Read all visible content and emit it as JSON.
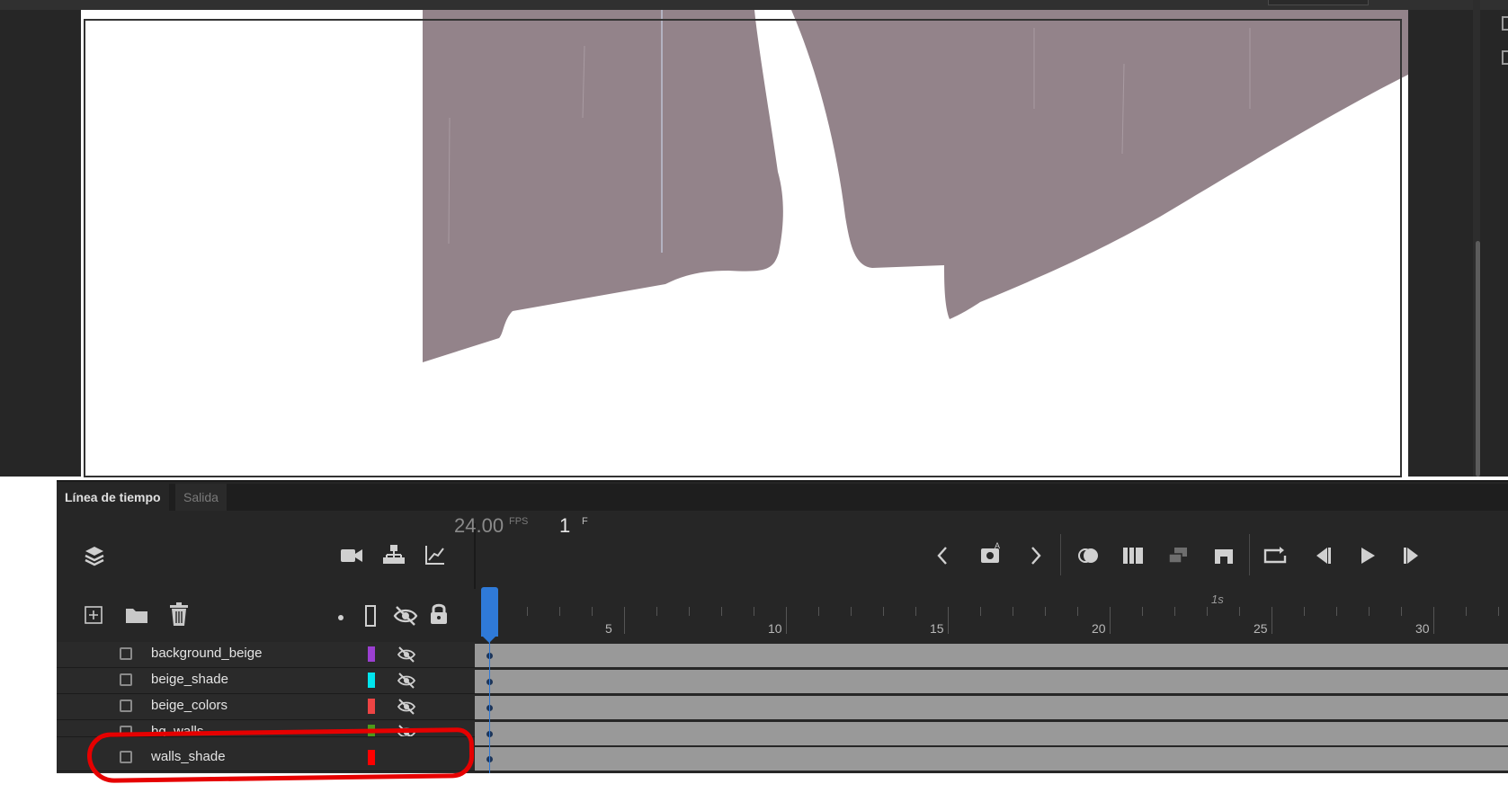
{
  "timeline": {
    "tabs": [
      {
        "label": "Línea de tiempo",
        "active": true
      },
      {
        "label": "Salida",
        "active": false
      }
    ],
    "fps_value": "24.00",
    "fps_unit": "FPS",
    "frame_value": "1",
    "frame_unit": "F",
    "ruler": {
      "labels": [
        "5",
        "10",
        "15",
        "20",
        "25",
        "30"
      ],
      "seconds_label": "1s"
    },
    "layers": [
      {
        "name": "background_beige",
        "color": "#9b3fd1",
        "hidden": true
      },
      {
        "name": "beige_shade",
        "color": "#00e5ee",
        "hidden": true
      },
      {
        "name": "beige_colors",
        "color": "#ee4444",
        "hidden": true
      },
      {
        "name": "bg_walls",
        "color": "#4c9a1a",
        "hidden": true
      },
      {
        "name": "walls_shade",
        "color": "#ff0000",
        "hidden": false
      }
    ],
    "icons": {
      "header_left": "layers-icon",
      "header_right": [
        "camera-icon",
        "layer-parenting-icon",
        "graph-icon"
      ],
      "layer_tools": [
        "add-layer-icon",
        "folder-icon",
        "trash-icon"
      ],
      "column_headers": [
        "dot-icon",
        "outline-icon",
        "eye-hidden-icon",
        "lock-icon"
      ],
      "playback": [
        "prev-keyframe-icon",
        "insert-keyframe-icon",
        "next-keyframe-icon",
        "onion-skin-icon",
        "edit-multiple-frames-icon",
        "frames-icon",
        "center-frame-icon",
        "loop-icon",
        "step-back-icon",
        "play-icon",
        "step-forward-icon"
      ]
    }
  },
  "stage": {
    "shape_color": "#93838a"
  },
  "annotation": {
    "color": "#e60000",
    "target": "walls_shade"
  }
}
